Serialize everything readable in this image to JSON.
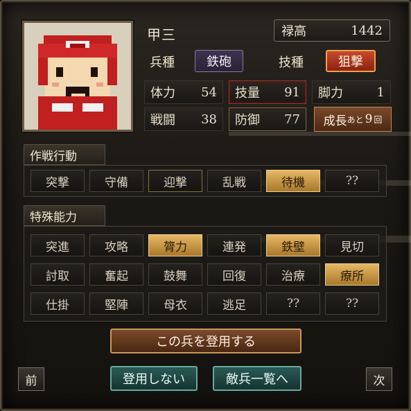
{
  "unit": {
    "name": "甲三",
    "stipend_label": "禄高",
    "stipend_value": "1442",
    "troop_type_label": "兵種",
    "troop_type_value": "鉄砲",
    "skill_type_label": "技種",
    "skill_type_value": "狙撃",
    "growth_label": "成長",
    "growth_ato": "あと",
    "growth_value": "9",
    "growth_unit": "回"
  },
  "stats": [
    {
      "label": "体力",
      "value": "54"
    },
    {
      "label": "技量",
      "value": "91"
    },
    {
      "label": "脚力",
      "value": "1"
    },
    {
      "label": "戦闘",
      "value": "38"
    },
    {
      "label": "防御",
      "value": "77"
    }
  ],
  "tactics": {
    "title": "作戦行動",
    "items": [
      {
        "label": "突撃",
        "selected": false
      },
      {
        "label": "守備",
        "selected": false
      },
      {
        "label": "迎撃",
        "selected": false
      },
      {
        "label": "乱戦",
        "selected": false
      },
      {
        "label": "待機",
        "selected": true
      },
      {
        "label": "??",
        "selected": false
      }
    ]
  },
  "abilities": {
    "title": "特殊能力",
    "items": [
      {
        "label": "突進",
        "selected": false
      },
      {
        "label": "攻略",
        "selected": false
      },
      {
        "label": "膂力",
        "selected": true
      },
      {
        "label": "連発",
        "selected": false
      },
      {
        "label": "鉄壁",
        "selected": true
      },
      {
        "label": "見切",
        "selected": false
      },
      {
        "label": "討取",
        "selected": false
      },
      {
        "label": "奮起",
        "selected": false
      },
      {
        "label": "鼓舞",
        "selected": false
      },
      {
        "label": "回復",
        "selected": false
      },
      {
        "label": "治療",
        "selected": false
      },
      {
        "label": "療所",
        "selected": true
      },
      {
        "label": "仕掛",
        "selected": false
      },
      {
        "label": "堅陣",
        "selected": false
      },
      {
        "label": "母衣",
        "selected": false
      },
      {
        "label": "逃足",
        "selected": false
      },
      {
        "label": "??",
        "selected": false
      },
      {
        "label": "??",
        "selected": false
      }
    ]
  },
  "buttons": {
    "recruit": "この兵を登用する",
    "no_recruit": "登用しない",
    "enemy_list": "敵兵一覧へ",
    "prev": "前",
    "next": "次"
  }
}
